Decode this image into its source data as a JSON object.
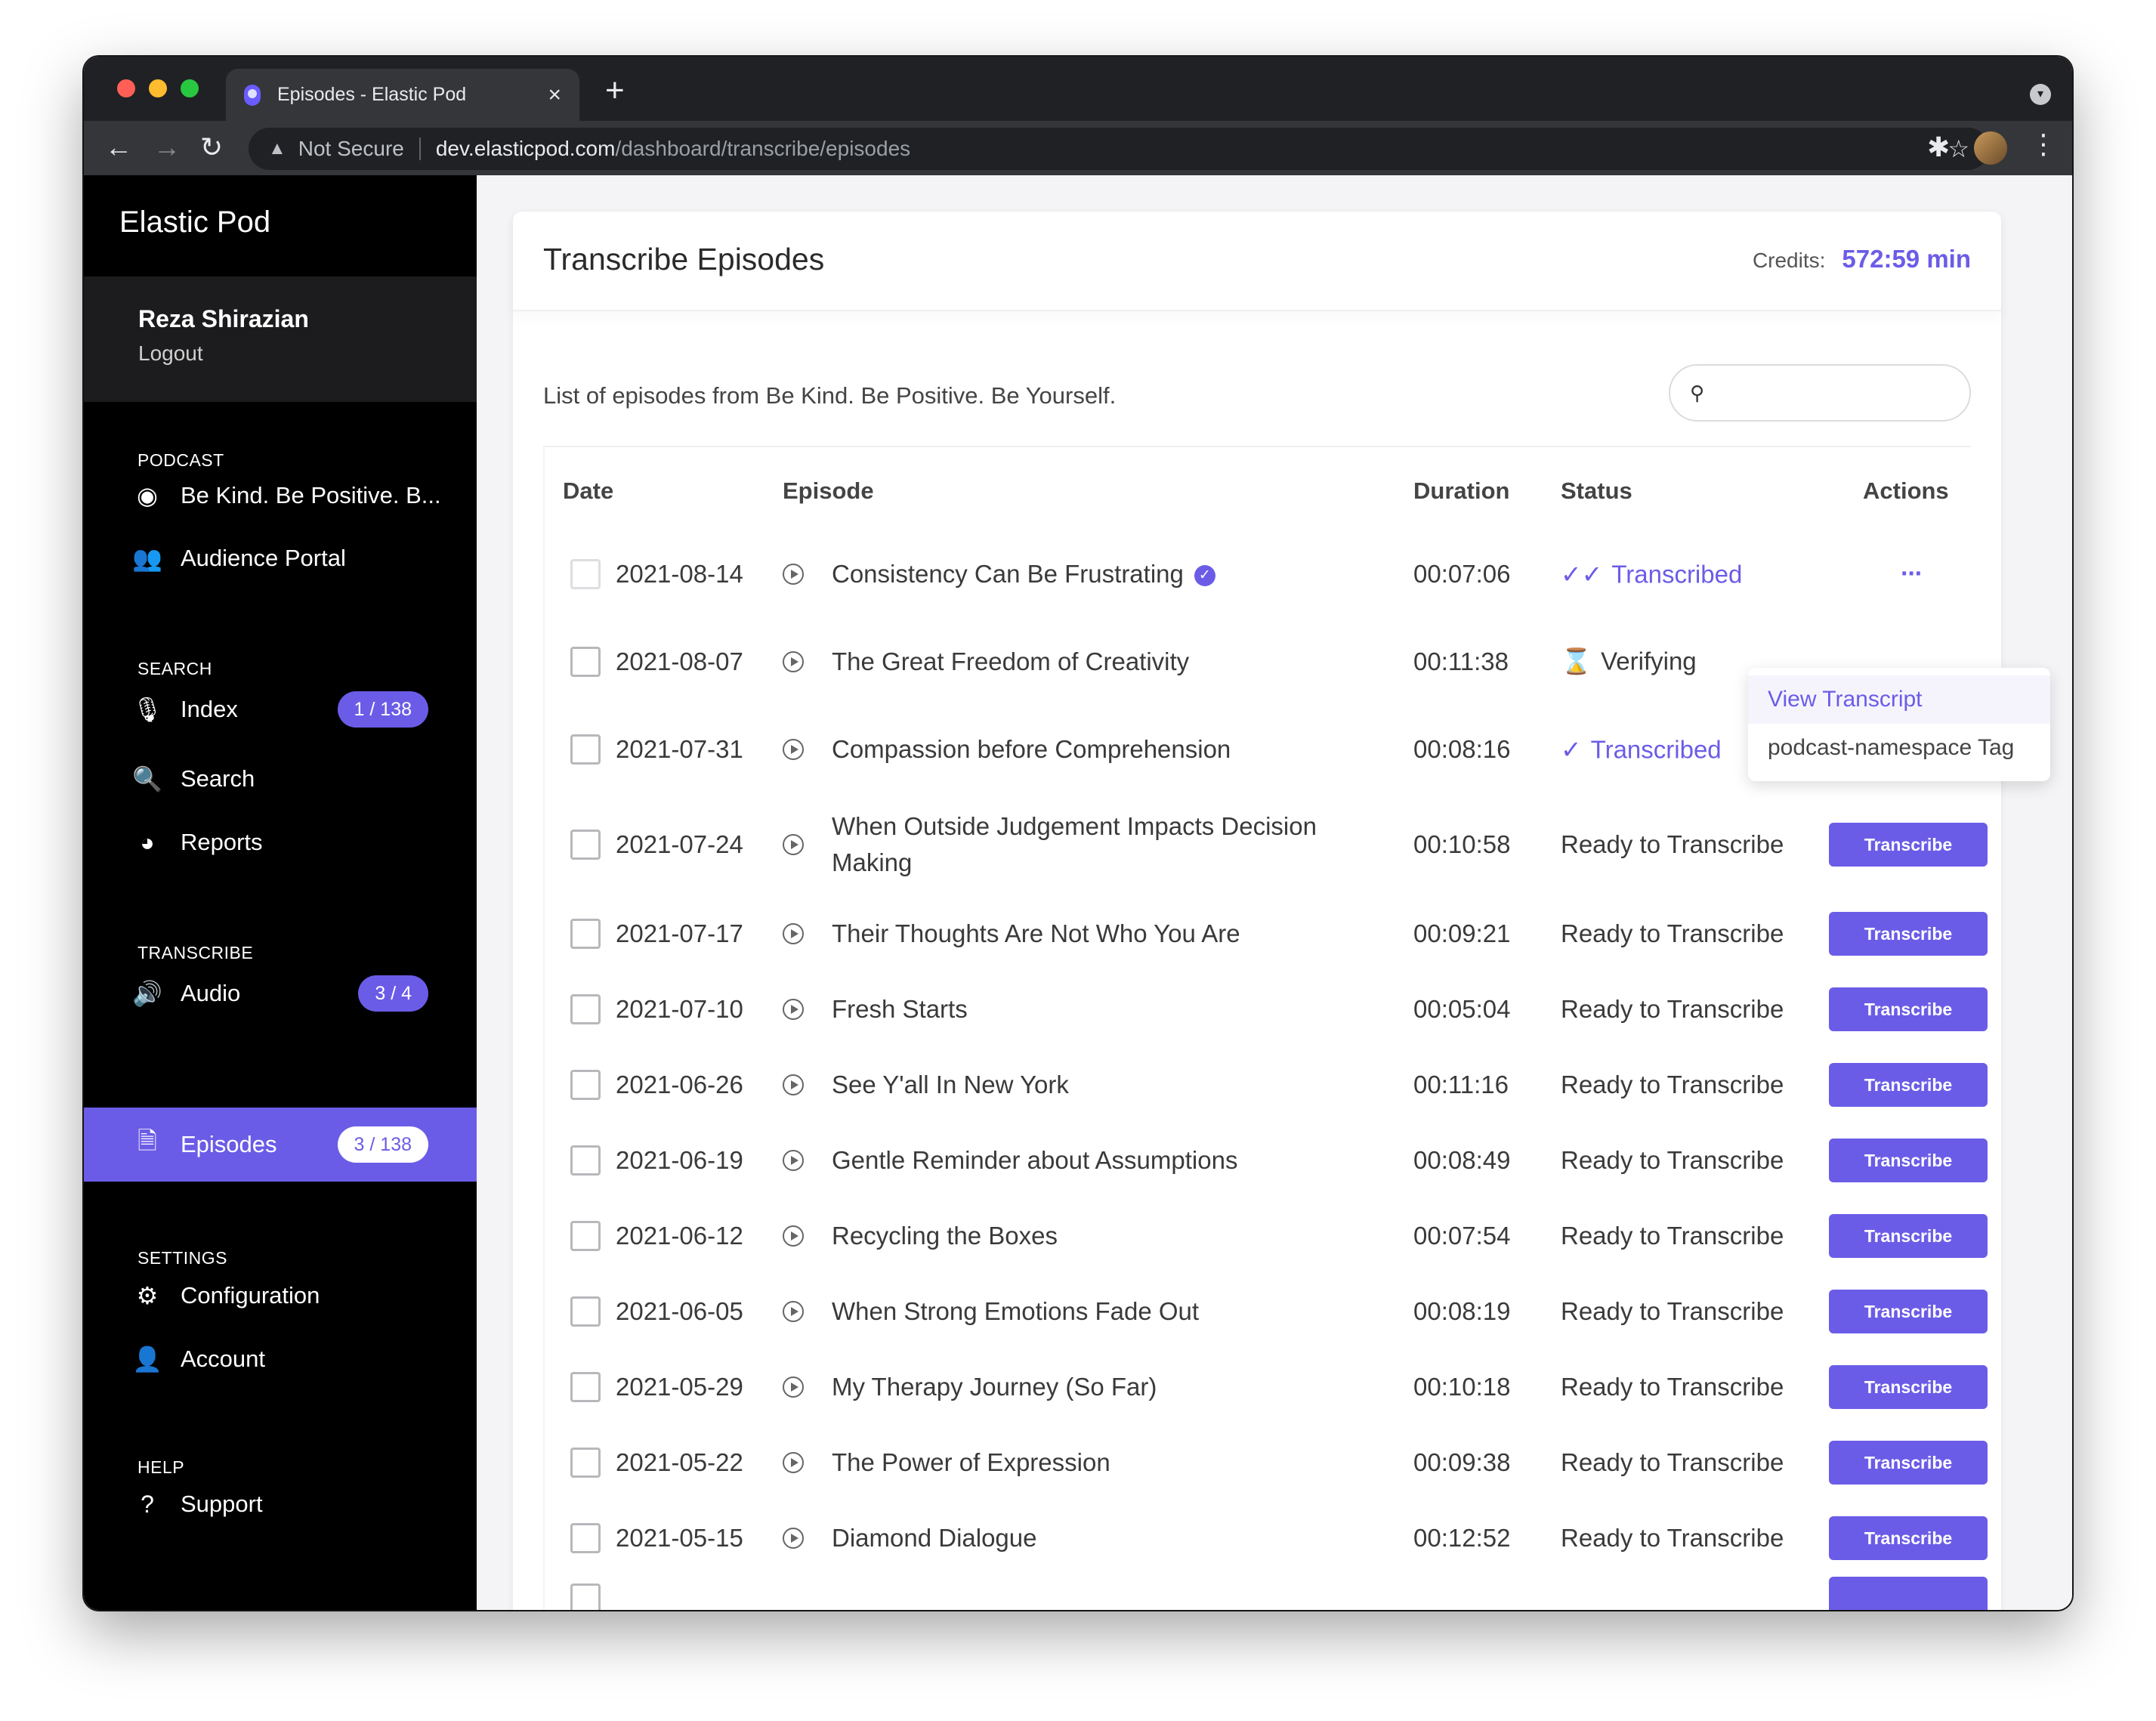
{
  "browser": {
    "tab_title": "Episodes - Elastic Pod",
    "not_secure": "Not Secure",
    "url_host": "dev.elasticpod.com",
    "url_path": "/dashboard/transcribe/episodes"
  },
  "sidebar": {
    "brand": "Elastic Pod",
    "user_name": "Reza Shirazian",
    "logout": "Logout",
    "sections": {
      "podcast": "PODCAST",
      "search": "SEARCH",
      "transcribe": "TRANSCRIBE",
      "settings": "SETTINGS",
      "help": "HELP"
    },
    "items": {
      "podcast_name": "Be Kind. Be Positive. B...",
      "audience_portal": "Audience Portal",
      "index": "Index",
      "index_badge": "1 / 138",
      "search": "Search",
      "reports": "Reports",
      "audio": "Audio",
      "audio_badge": "3 / 4",
      "episodes": "Episodes",
      "episodes_badge": "3 / 138",
      "configuration": "Configuration",
      "account": "Account",
      "support": "Support"
    }
  },
  "main": {
    "title": "Transcribe Episodes",
    "credits_label": "Credits:",
    "credits_value": "572:59 min",
    "caption": "List of episodes from Be Kind. Be Positive. Be Yourself.",
    "search_placeholder": "",
    "headers": {
      "date": "Date",
      "episode": "Episode",
      "duration": "Duration",
      "status": "Status",
      "actions": "Actions"
    },
    "transcribe_label": "Transcribe",
    "rows": [
      {
        "date": "2021-08-14",
        "episode": "Consistency Can Be Frustrating",
        "duration": "00:07:06",
        "status": "Transcribed"
      },
      {
        "date": "2021-08-07",
        "episode": "The Great Freedom of Creativity",
        "duration": "00:11:38",
        "status": "Verifying"
      },
      {
        "date": "2021-07-31",
        "episode": "Compassion before Comprehension",
        "duration": "00:08:16",
        "status": "Transcribed"
      },
      {
        "date": "2021-07-24",
        "episode": "When Outside Judgement Impacts Decision Making",
        "duration": "00:10:58",
        "status": "Ready to Transcribe"
      },
      {
        "date": "2021-07-17",
        "episode": "Their Thoughts Are Not Who You Are",
        "duration": "00:09:21",
        "status": "Ready to Transcribe"
      },
      {
        "date": "2021-07-10",
        "episode": "Fresh Starts",
        "duration": "00:05:04",
        "status": "Ready to Transcribe"
      },
      {
        "date": "2021-06-26",
        "episode": "See Y'all In New York",
        "duration": "00:11:16",
        "status": "Ready to Transcribe"
      },
      {
        "date": "2021-06-19",
        "episode": "Gentle Reminder about Assumptions",
        "duration": "00:08:49",
        "status": "Ready to Transcribe"
      },
      {
        "date": "2021-06-12",
        "episode": "Recycling the Boxes",
        "duration": "00:07:54",
        "status": "Ready to Transcribe"
      },
      {
        "date": "2021-06-05",
        "episode": "When Strong Emotions Fade Out",
        "duration": "00:08:19",
        "status": "Ready to Transcribe"
      },
      {
        "date": "2021-05-29",
        "episode": "My Therapy Journey (So Far)",
        "duration": "00:10:18",
        "status": "Ready to Transcribe"
      },
      {
        "date": "2021-05-22",
        "episode": "The Power of Expression",
        "duration": "00:09:38",
        "status": "Ready to Transcribe"
      },
      {
        "date": "2021-05-15",
        "episode": "Diamond Dialogue",
        "duration": "00:12:52",
        "status": "Ready to Transcribe"
      }
    ],
    "dropdown": {
      "view_transcript": "View Transcript",
      "namespace_tag": "podcast-namespace Tag"
    }
  },
  "colors": {
    "accent": "#6b5ce7",
    "sidebar_bg": "#000000"
  }
}
